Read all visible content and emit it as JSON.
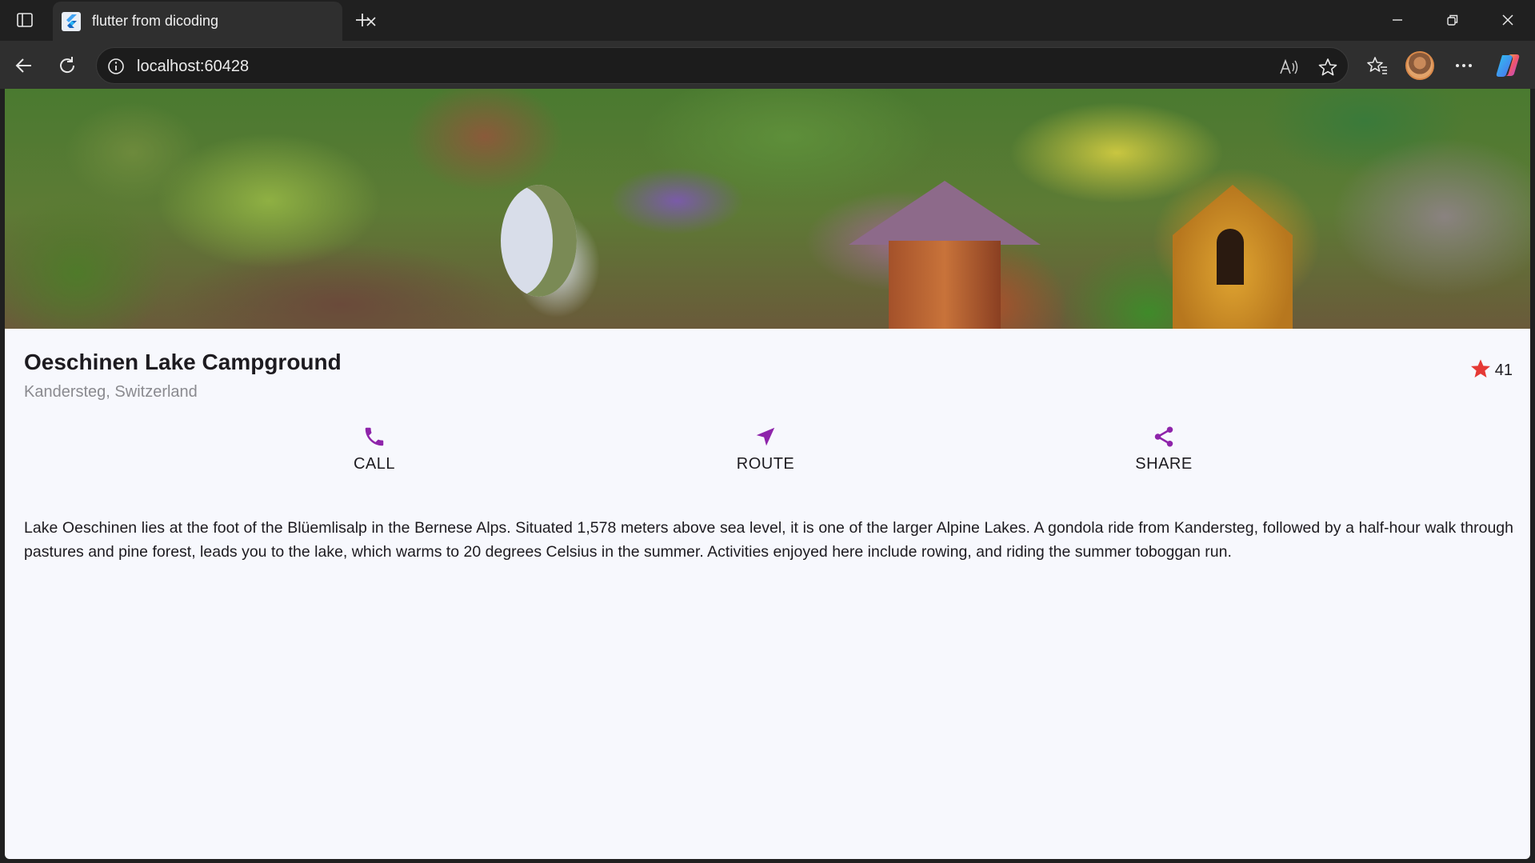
{
  "browser": {
    "tab": {
      "title": "flutter from dicoding",
      "favicon": "flutter-logo-icon"
    },
    "url": "localhost:60428",
    "icons": {
      "tab_actions": "tab-actions-icon",
      "close_tab": "close-icon",
      "new_tab": "plus-icon",
      "minimize": "minimize-icon",
      "restore": "restore-icon",
      "close_window": "close-icon",
      "back": "back-arrow-icon",
      "refresh": "refresh-icon",
      "site_info": "info-icon",
      "read_aloud": "read-aloud-icon",
      "favorite": "star-outline-icon",
      "favorites": "favorites-icon",
      "profile": "avatar",
      "more": "more-icon",
      "copilot": "copilot-icon"
    }
  },
  "place": {
    "title": "Oeschinen Lake Campground",
    "location": "Kandersteg, Switzerland",
    "rating_count": "41",
    "star_color": "#e53935",
    "actions": [
      {
        "label": "CALL",
        "icon": "phone-icon"
      },
      {
        "label": "ROUTE",
        "icon": "navigation-icon"
      },
      {
        "label": "SHARE",
        "icon": "share-icon"
      }
    ],
    "accent_color": "#8e24aa",
    "description": "Lake Oeschinen lies at the foot of the Blüemlisalp in the Bernese Alps. Situated 1,578 meters above sea level, it is one of the larger Alpine Lakes. A gondola ride from Kandersteg, followed by a half-hour walk through pastures and pine forest, leads you to the lake, which warms to 20 degrees Celsius in the summer. Activities enjoyed here include rowing, and riding the summer toboggan run."
  }
}
